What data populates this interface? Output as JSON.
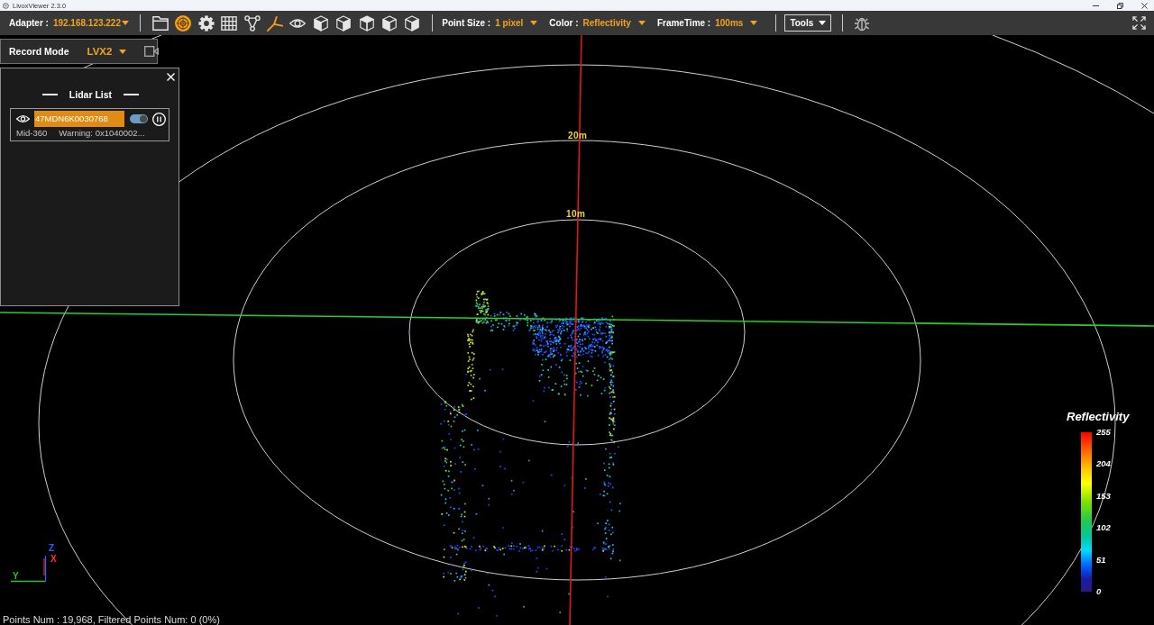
{
  "window": {
    "title": "LivoxViewer 2.3.0"
  },
  "toolbar": {
    "adapter": {
      "label": "Adapter :",
      "value": "192.168.123.222"
    },
    "tool_buttons": [
      {
        "kind": "folder",
        "active": false
      },
      {
        "kind": "radar",
        "active": true
      },
      {
        "kind": "gear",
        "active": false
      },
      {
        "kind": "grid",
        "active": false
      },
      {
        "kind": "graph",
        "active": false
      },
      {
        "kind": "axes",
        "active": true
      },
      {
        "kind": "eye",
        "active": false
      },
      {
        "kind": "cube",
        "active": false
      },
      {
        "kind": "cube",
        "active": false
      },
      {
        "kind": "cube",
        "active": false
      },
      {
        "kind": "cube",
        "active": false
      },
      {
        "kind": "cube",
        "active": false
      }
    ],
    "settings": [
      {
        "label": "Point Size :",
        "value": "1 pixel"
      },
      {
        "label": "Color :",
        "value": "Reflectivity"
      },
      {
        "label": "FrameTime :",
        "value": "100ms"
      }
    ],
    "tools_button": "Tools"
  },
  "record_mode": {
    "label": "Record Mode",
    "value": "LVX2"
  },
  "lidar_list": {
    "title": "Lidar List",
    "devices": [
      {
        "serial": "47MDN6K0030768",
        "selected": true,
        "on": true,
        "model": "Mid-360",
        "status": "Warning: 0x1040002..."
      }
    ]
  },
  "viewport": {
    "range_labels": [
      "20m",
      "10m"
    ],
    "axes": [
      {
        "label": "Z",
        "color": "#3060ff"
      },
      {
        "label": "X",
        "color": "#ff3030"
      },
      {
        "label": "Y",
        "color": "#30c030"
      }
    ],
    "legend": {
      "title": "Reflectivity",
      "ticks": [
        "255",
        "204",
        "153",
        "102",
        "51",
        "0"
      ]
    }
  },
  "status_bar": {
    "text": "Points Num : 19,968, Filtered Points Num: 0 (0%)"
  }
}
